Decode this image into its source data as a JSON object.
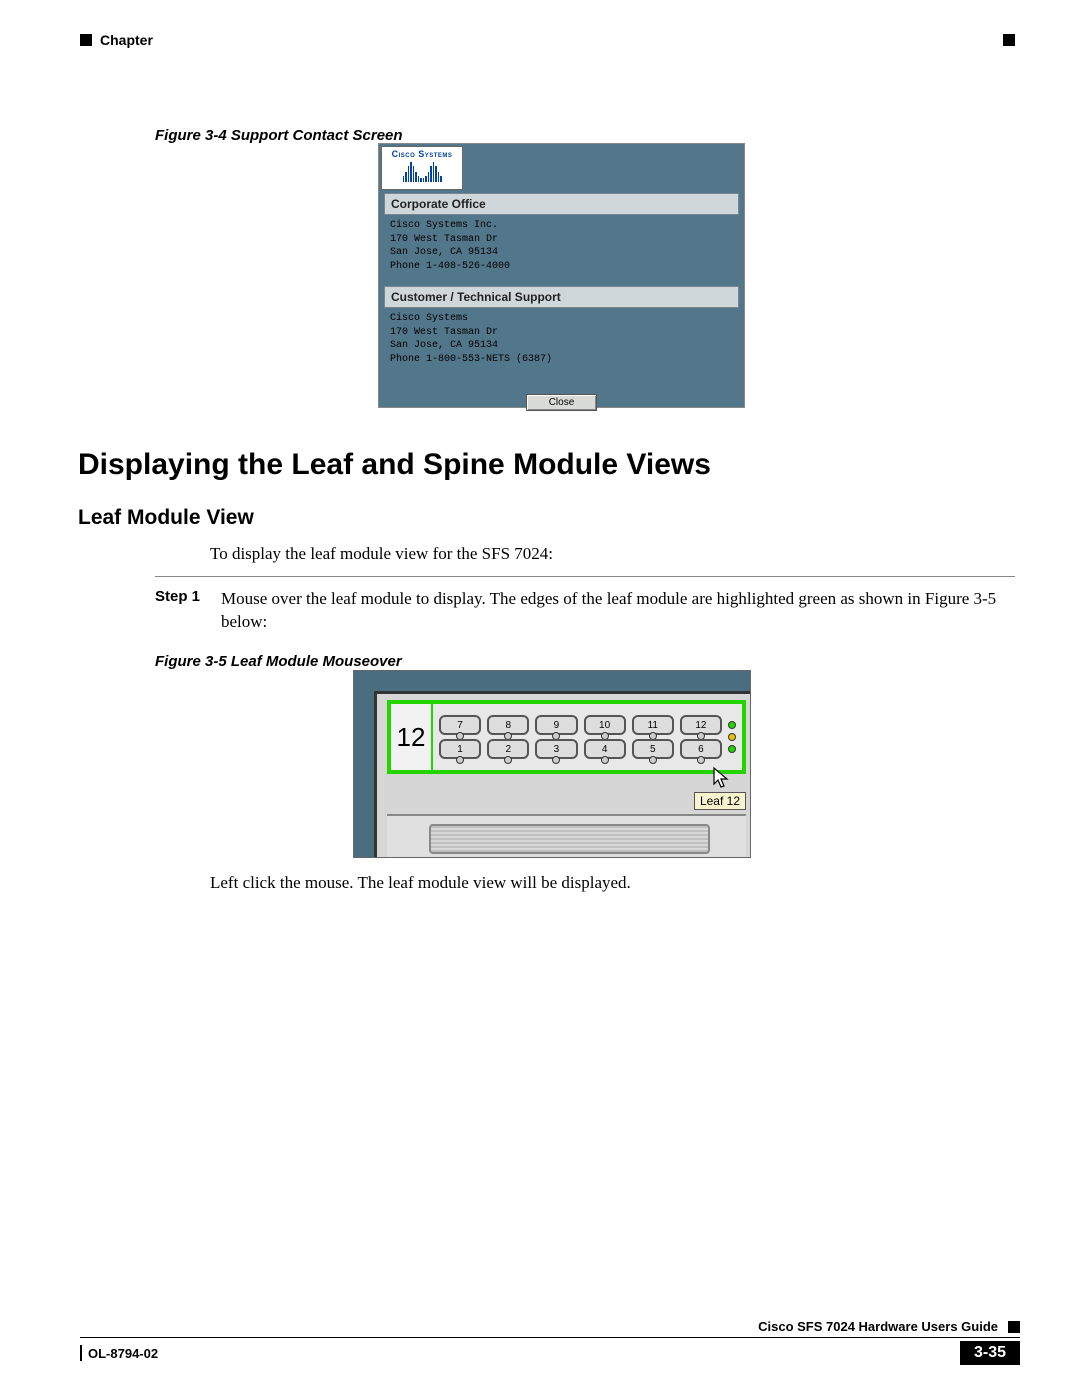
{
  "header": {
    "chapter_label": "Chapter"
  },
  "fig34": {
    "caption": "Figure 3-4    Support Contact Screen",
    "logo_text": "Cisco Systems",
    "corp_heading": "Corporate Office",
    "corp_lines": [
      "Cisco Systems Inc.",
      "170 West Tasman Dr",
      "San Jose, CA 95134",
      "Phone 1-408-526-4000"
    ],
    "support_heading": "Customer / Technical Support",
    "support_lines": [
      "Cisco Systems",
      "170 West Tasman Dr",
      "San Jose, CA 95134",
      "Phone 1-800-553-NETS (6387)"
    ],
    "close_label": "Close"
  },
  "headings": {
    "h1": "Displaying the Leaf and Spine Module Views",
    "h2": "Leaf Module View"
  },
  "intro": "To display the leaf module view for the SFS 7024:",
  "step1": {
    "label": "Step 1",
    "text": "Mouse over the leaf module to display. The edges of the leaf module are highlighted green as shown in Figure 3-5 below:"
  },
  "fig35": {
    "caption": "Figure 3-5    Leaf Module Mouseover",
    "module_number": "12",
    "ports_top": [
      "7",
      "8",
      "9",
      "10",
      "11",
      "12"
    ],
    "ports_bottom": [
      "1",
      "2",
      "3",
      "4",
      "5",
      "6"
    ],
    "tooltip": "Leaf 12"
  },
  "after": "Left click the mouse. The leaf module view will be displayed.",
  "footer": {
    "guide": "Cisco SFS 7024 Hardware Users Guide",
    "doc_id": "OL-8794-02",
    "page": "3-35"
  }
}
